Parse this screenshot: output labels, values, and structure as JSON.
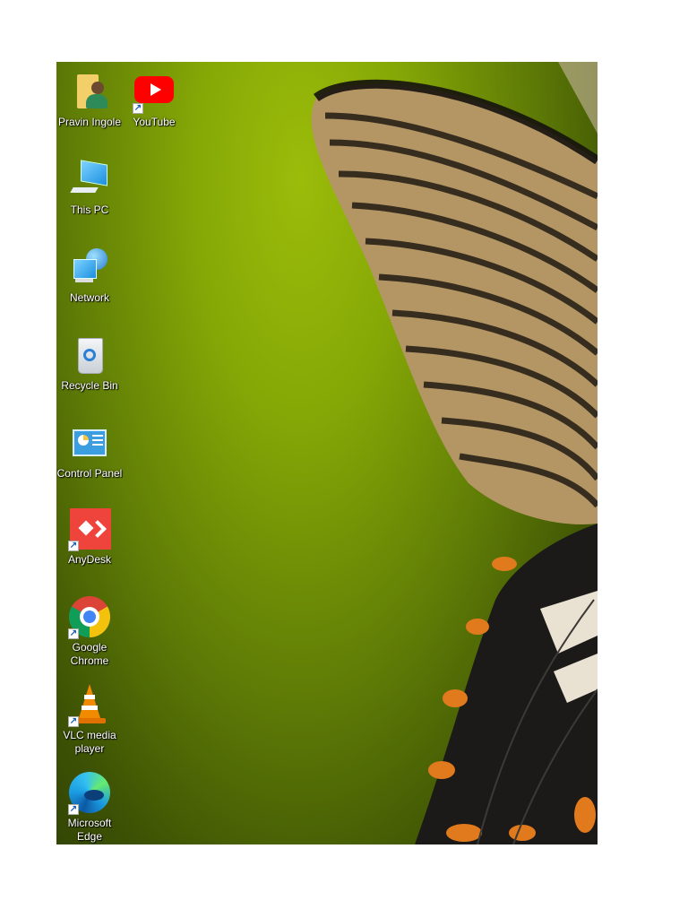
{
  "desktop_icons": [
    {
      "id": "pravin-ingole",
      "label": "Pravin Ingole",
      "icon": "user-folder-icon",
      "shortcut": false
    },
    {
      "id": "youtube",
      "label": "YouTube",
      "icon": "youtube-icon",
      "shortcut": true
    },
    {
      "id": "this-pc",
      "label": "This PC",
      "icon": "computer-icon",
      "shortcut": false
    },
    {
      "id": "network",
      "label": "Network",
      "icon": "network-icon",
      "shortcut": false
    },
    {
      "id": "recycle-bin",
      "label": "Recycle Bin",
      "icon": "recycle-bin-icon",
      "shortcut": false
    },
    {
      "id": "control-panel",
      "label": "Control Panel",
      "icon": "control-panel-icon",
      "shortcut": false
    },
    {
      "id": "anydesk",
      "label": "AnyDesk",
      "icon": "anydesk-icon",
      "shortcut": true
    },
    {
      "id": "google-chrome",
      "label": "Google Chrome",
      "icon": "chrome-icon",
      "shortcut": true
    },
    {
      "id": "vlc",
      "label": "VLC media player",
      "icon": "vlc-cone-icon",
      "shortcut": true
    },
    {
      "id": "edge",
      "label": "Microsoft Edge",
      "icon": "edge-icon",
      "shortcut": true
    }
  ],
  "colors": {
    "wallpaper_green": "#8fb00a",
    "wing_tan": "#b89a6a",
    "wing_dark": "#1e1a14",
    "spot_orange": "#e07a1c"
  }
}
